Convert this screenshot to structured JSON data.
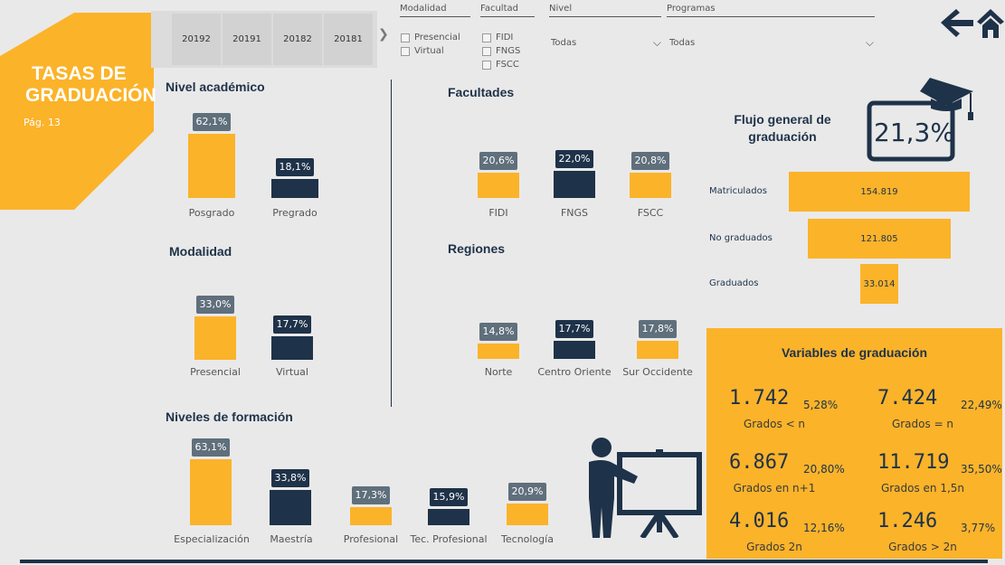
{
  "title": {
    "line1": "TASAS DE",
    "line2": "GRADUACIÓN",
    "page": "Pág. 13"
  },
  "periods": [
    "20192",
    "20191",
    "20182",
    "20181"
  ],
  "filters": {
    "modalidad": {
      "label": "Modalidad",
      "options": [
        "Presencial",
        "Virtual"
      ]
    },
    "facultad": {
      "label": "Facultad",
      "options": [
        "FIDI",
        "FNGS",
        "FSCC"
      ]
    },
    "nivel": {
      "label": "Nivel",
      "value": "Todas"
    },
    "programas": {
      "label": "Programas",
      "value": "Todas"
    }
  },
  "sections": {
    "nivel_academico": "Nivel académico",
    "modalidad": "Modalidad",
    "niveles_formacion": "Niveles de formación",
    "facultades": "Facultades",
    "regiones": "Regiones"
  },
  "chart_data": [
    {
      "type": "bar",
      "title": "Nivel académico",
      "categories": [
        "Posgrado",
        "Pregrado"
      ],
      "values": [
        62.1,
        18.1
      ],
      "labels": [
        "62,1%",
        "18,1%"
      ]
    },
    {
      "type": "bar",
      "title": "Modalidad",
      "categories": [
        "Presencial",
        "Virtual"
      ],
      "values": [
        33.0,
        17.7
      ],
      "labels": [
        "33,0%",
        "17,7%"
      ]
    },
    {
      "type": "bar",
      "title": "Niveles de formación",
      "categories": [
        "Especialización",
        "Maestría",
        "Profesional",
        "Tec. Profesional",
        "Tecnología"
      ],
      "values": [
        63.1,
        33.8,
        17.3,
        15.9,
        20.9
      ],
      "labels": [
        "63,1%",
        "33,8%",
        "17,3%",
        "15,9%",
        "20,9%"
      ]
    },
    {
      "type": "bar",
      "title": "Facultades",
      "categories": [
        "FIDI",
        "FNGS",
        "FSCC"
      ],
      "values": [
        20.6,
        22.0,
        20.8
      ],
      "labels": [
        "20,6%",
        "22,0%",
        "20,8%"
      ]
    },
    {
      "type": "bar",
      "title": "Regiones",
      "categories": [
        "Norte",
        "Centro Oriente",
        "Sur Occidente"
      ],
      "values": [
        14.8,
        17.7,
        17.8
      ],
      "labels": [
        "14,8%",
        "17,7%",
        "17,8%"
      ]
    },
    {
      "type": "bar",
      "title": "Flujo general de graduación",
      "categories": [
        "Matriculados",
        "No graduados",
        "Graduados"
      ],
      "values": [
        154819,
        121805,
        33014
      ],
      "labels": [
        "154.819",
        "121.805",
        "33.014"
      ]
    }
  ],
  "flujo": {
    "title_line1": "Flujo general de",
    "title_line2": "graduación",
    "rate": "21,3%"
  },
  "variables": {
    "title": "Variables de graduación",
    "items": [
      {
        "value": "1.742",
        "pct": "5,28%",
        "caption": "Grados < n"
      },
      {
        "value": "7.424",
        "pct": "22,49%",
        "caption": "Grados = n"
      },
      {
        "value": "6.867",
        "pct": "20,80%",
        "caption": "Grados en n+1"
      },
      {
        "value": "11.719",
        "pct": "35,50%",
        "caption": "Grados  en 1,5n"
      },
      {
        "value": "4.016",
        "pct": "12,16%",
        "caption": "Grados  2n"
      },
      {
        "value": "1.246",
        "pct": "3,77%",
        "caption": "Grados > 2n"
      }
    ]
  },
  "colors": {
    "orange": "#fbb32a",
    "navy": "#1e3249",
    "label_gray": "#5f6f7c",
    "background": "#e9e9e9"
  },
  "icons": [
    "back-arrow-icon",
    "home-icon",
    "graduation-cap-icon",
    "teacher-board-icon"
  ]
}
